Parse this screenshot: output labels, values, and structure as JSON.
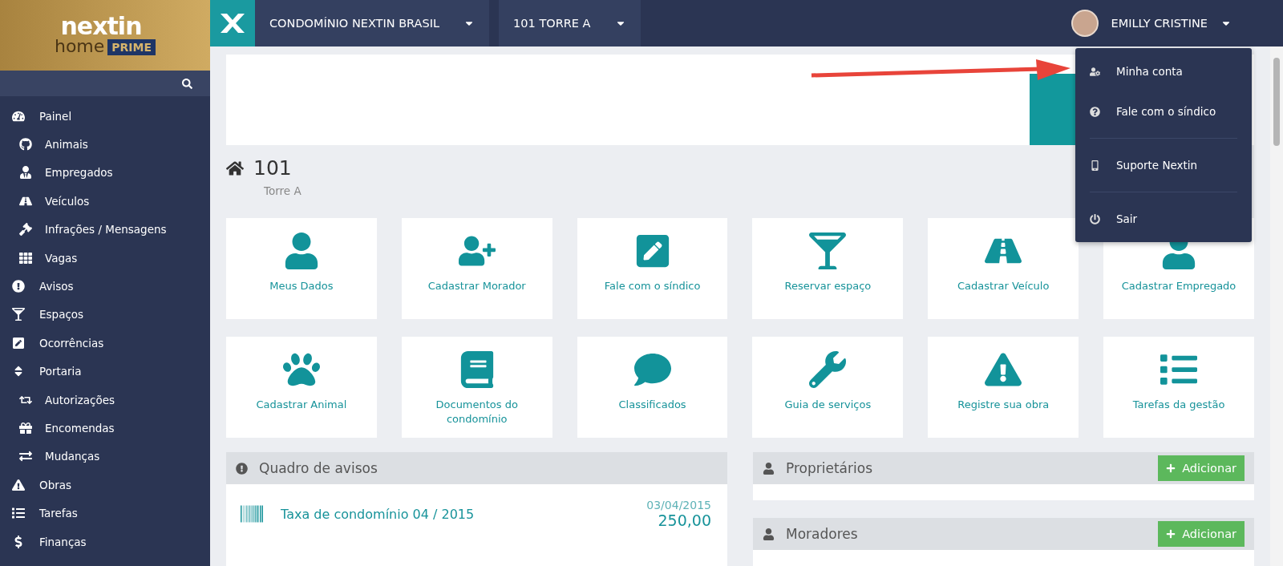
{
  "logo": {
    "word": "nextin",
    "sub": "home",
    "badge": "PRIME"
  },
  "topbar": {
    "selectors": [
      {
        "label": "CONDOMÍNIO NEXTIN BRASIL"
      },
      {
        "label": "101 TORRE A"
      }
    ],
    "user": "EMILLY CRISTINE"
  },
  "user_menu": {
    "items": [
      {
        "label": "Minha conta"
      },
      {
        "label": "Fale com o síndico"
      },
      {
        "label": "Suporte Nextin"
      },
      {
        "label": "Sair"
      }
    ]
  },
  "sidebar": {
    "items": [
      {
        "label": "Painel",
        "children": [
          {
            "label": "Animais"
          },
          {
            "label": "Empregados"
          },
          {
            "label": "Veículos"
          },
          {
            "label": "Infrações / Mensagens"
          },
          {
            "label": "Vagas"
          }
        ]
      },
      {
        "label": "Avisos"
      },
      {
        "label": "Espaços"
      },
      {
        "label": "Ocorrências"
      },
      {
        "label": "Portaria",
        "children": [
          {
            "label": "Autorizações"
          },
          {
            "label": "Encomendas"
          },
          {
            "label": "Mudanças"
          }
        ]
      },
      {
        "label": "Obras"
      },
      {
        "label": "Tarefas"
      },
      {
        "label": "Finanças"
      }
    ]
  },
  "unit": {
    "number": "101",
    "tower": "Torre A"
  },
  "shortcuts": [
    {
      "label": "Meus Dados"
    },
    {
      "label": "Cadastrar Morador"
    },
    {
      "label": "Fale com o síndico"
    },
    {
      "label": "Reservar espaço"
    },
    {
      "label": "Cadastrar Veículo"
    },
    {
      "label": "Cadastrar Empregado"
    },
    {
      "label": "Cadastrar Animal"
    },
    {
      "label": "Documentos do condomínio"
    },
    {
      "label": "Classificados"
    },
    {
      "label": "Guia de serviços"
    },
    {
      "label": "Registre sua obra"
    },
    {
      "label": "Tarefas da gestão"
    }
  ],
  "notice_board": {
    "title": "Quadro de avisos",
    "items": [
      {
        "title": "Taxa de condomínio 04 / 2015",
        "date": "03/04/2015",
        "amount": "250,00"
      }
    ]
  },
  "people_panels": [
    {
      "title": "Proprietários",
      "button": "Adicionar"
    },
    {
      "title": "Moradores",
      "button": "Adicionar"
    }
  ]
}
